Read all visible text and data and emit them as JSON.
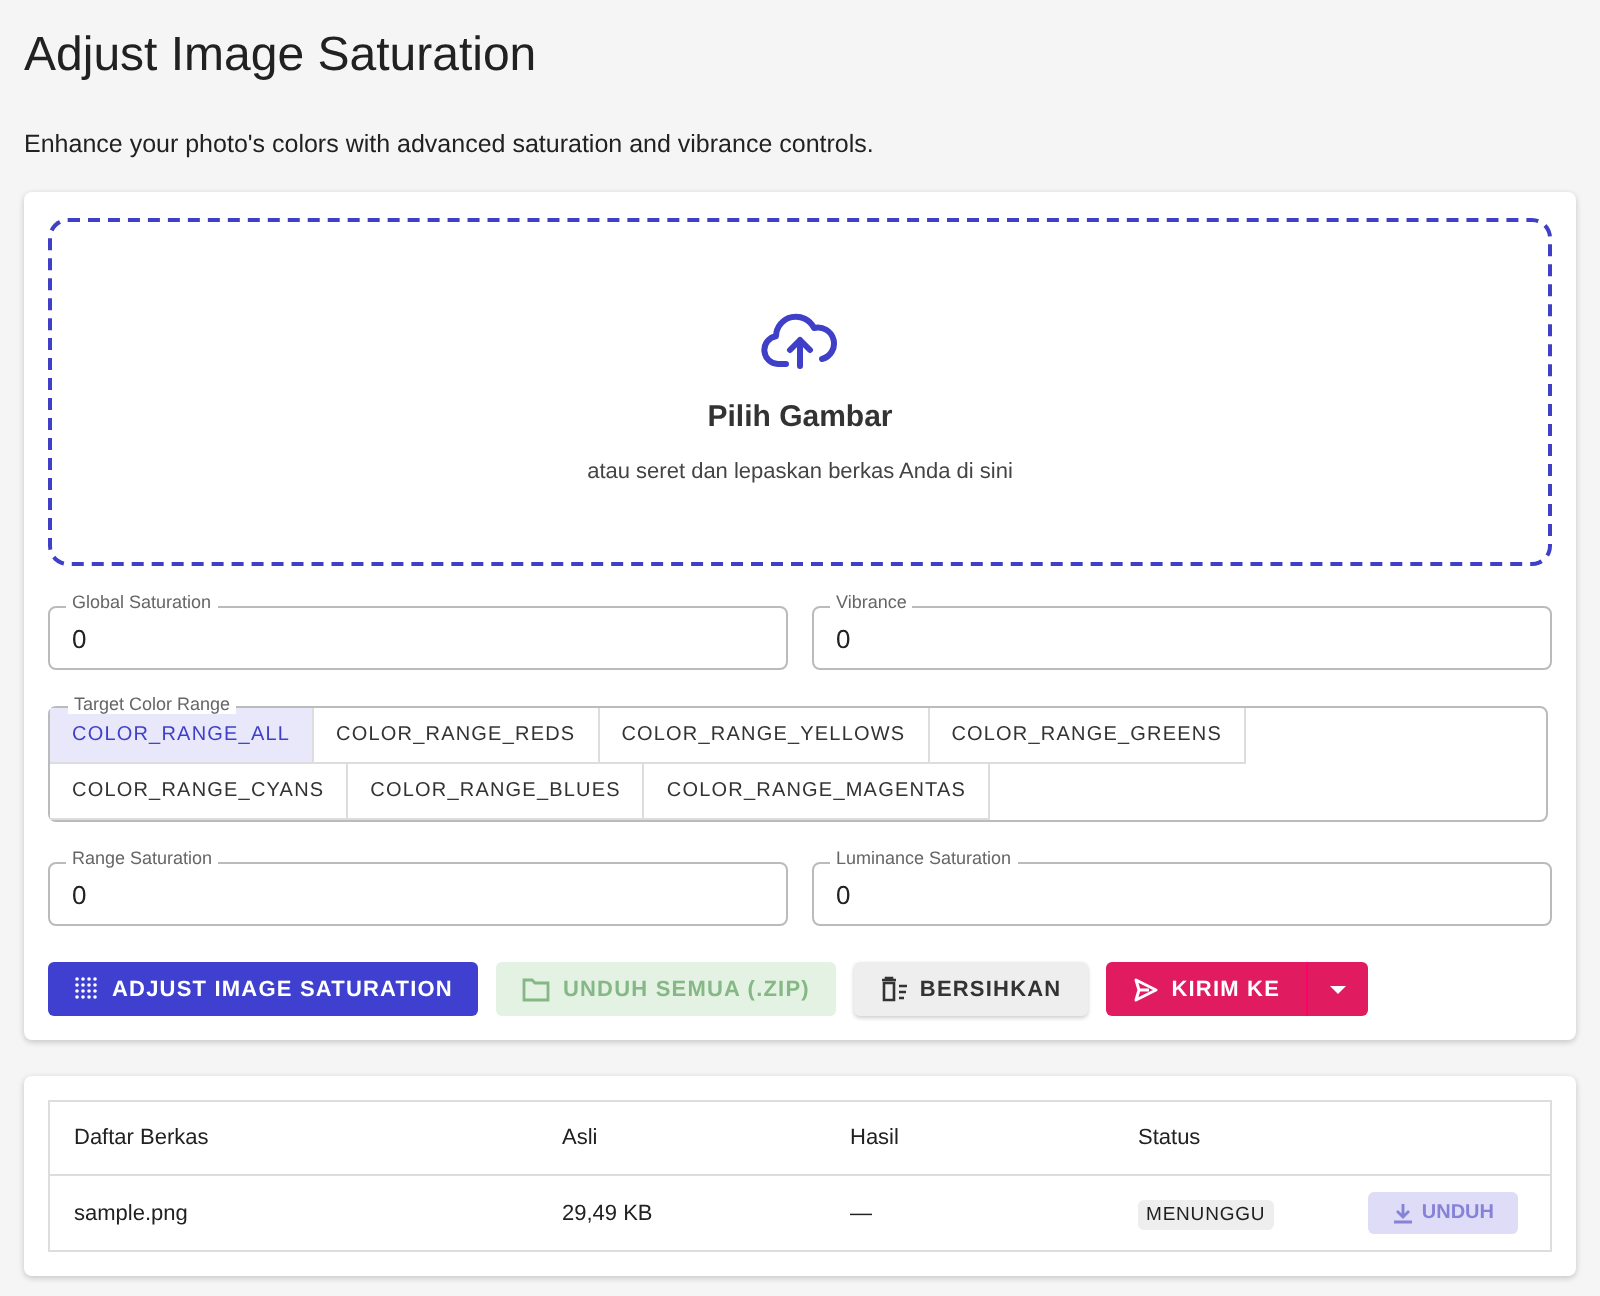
{
  "title": "Adjust Image Saturation",
  "description": "Enhance your photo's colors with advanced saturation and vibrance controls.",
  "dropzone": {
    "title": "Pilih Gambar",
    "hint": "atau seret dan lepaskan berkas Anda di sini"
  },
  "fields_top": [
    {
      "label": "Global Saturation",
      "value": "0"
    },
    {
      "label": "Vibrance",
      "value": "0"
    }
  ],
  "color_range": {
    "label": "Target Color Range",
    "options": [
      {
        "label": "COLOR_RANGE_ALL",
        "selected": true
      },
      {
        "label": "COLOR_RANGE_REDS",
        "selected": false
      },
      {
        "label": "COLOR_RANGE_YELLOWS",
        "selected": false
      },
      {
        "label": "COLOR_RANGE_GREENS",
        "selected": false
      },
      {
        "label": "COLOR_RANGE_CYANS",
        "selected": false
      },
      {
        "label": "COLOR_RANGE_BLUES",
        "selected": false
      },
      {
        "label": "COLOR_RANGE_MAGENTAS",
        "selected": false
      }
    ]
  },
  "fields_bottom": [
    {
      "label": "Range Saturation",
      "value": "0"
    },
    {
      "label": "Luminance Saturation",
      "value": "0"
    }
  ],
  "buttons": [
    {
      "kind": "primary",
      "label": "ADJUST IMAGE SATURATION",
      "disabled": false
    },
    {
      "kind": "zip",
      "label": "UNDUH SEMUA (.ZIP)",
      "disabled": true
    },
    {
      "kind": "clear",
      "label": "BERSIHKAN",
      "disabled": false
    },
    {
      "kind": "send",
      "label": "KIRIM KE",
      "disabled": false
    }
  ],
  "table": {
    "columns": [
      "Daftar Berkas",
      "Asli",
      "Hasil",
      "Status"
    ],
    "rows": [
      {
        "name": "sample.png",
        "original": "29,49 KB",
        "result": "—",
        "status": "MENUNGGU",
        "action": {
          "label": "UNDUH",
          "disabled": true
        }
      }
    ]
  }
}
